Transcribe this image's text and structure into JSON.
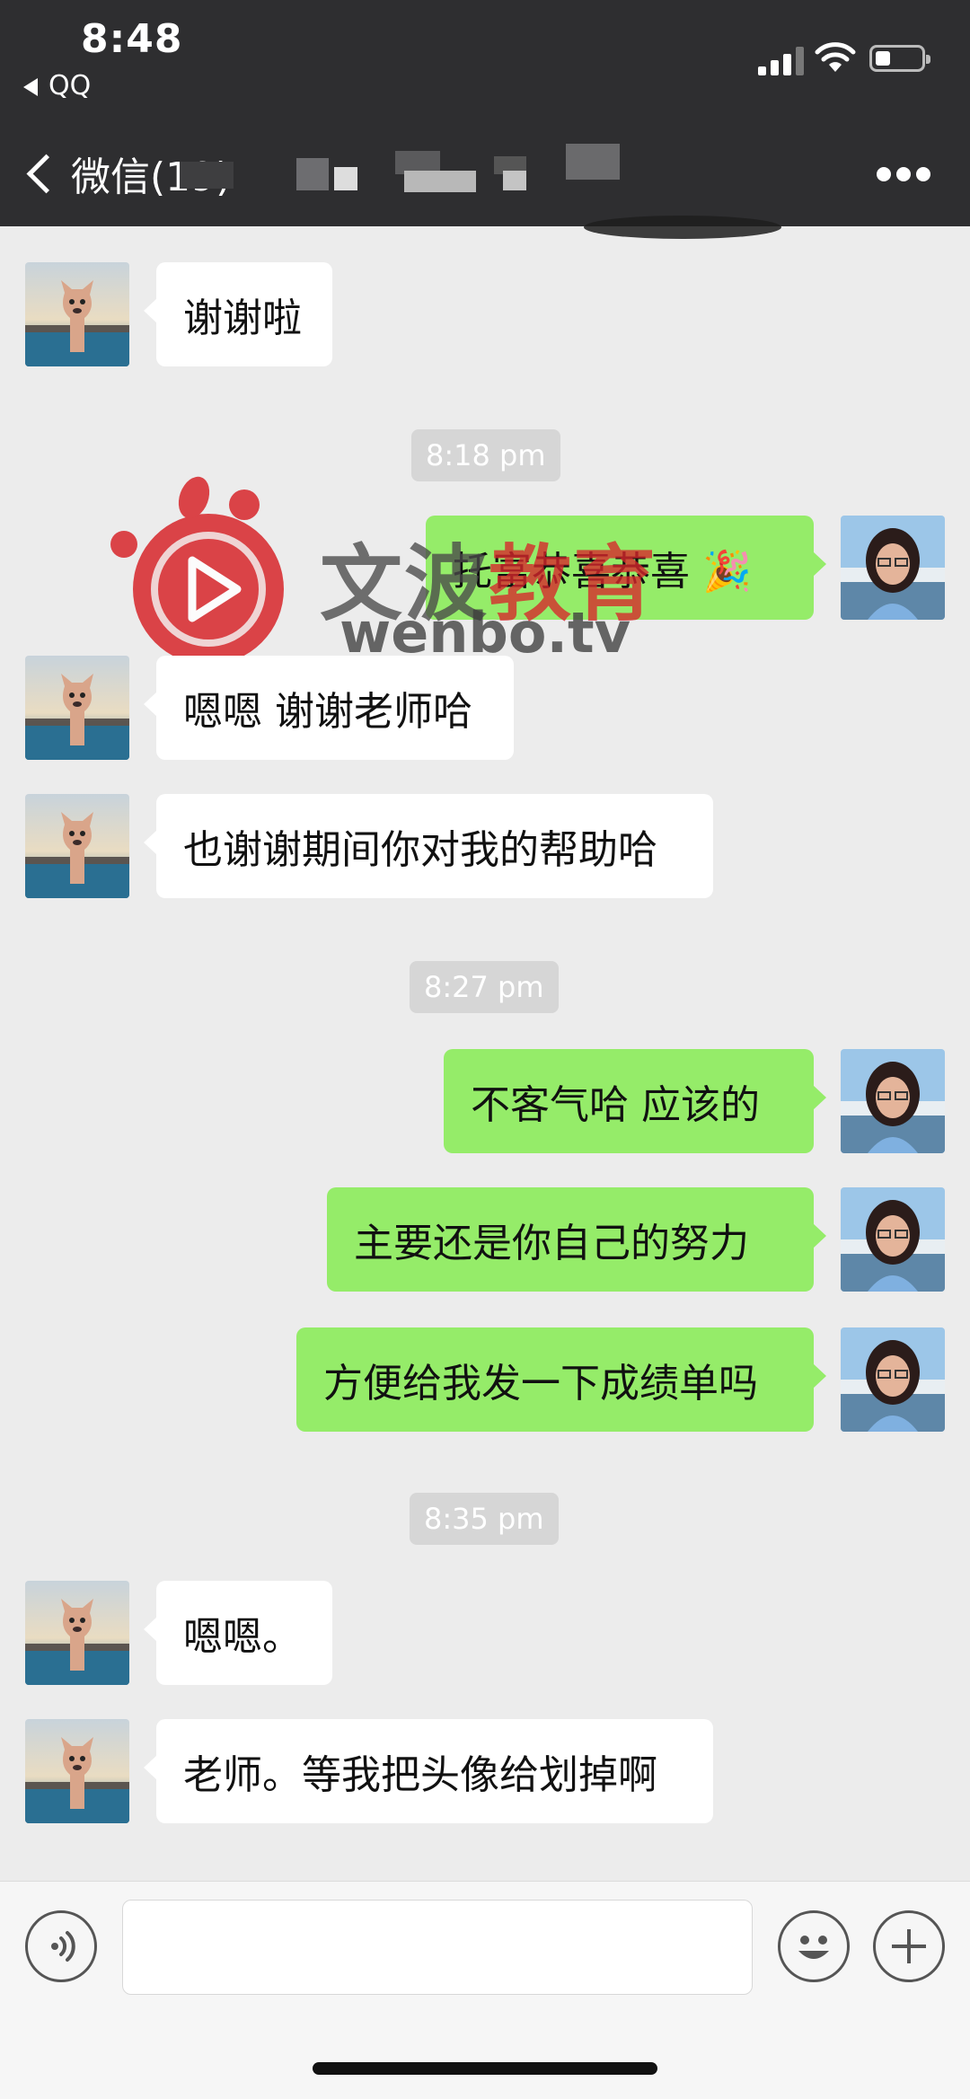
{
  "status_bar": {
    "time": "8:48",
    "back_app": "QQ",
    "signal_icon": "cellular-signal-icon",
    "wifi_icon": "wifi-icon",
    "battery_icon": "battery-icon"
  },
  "nav": {
    "back_label": "微信(19)",
    "back_icon": "chevron-left-icon",
    "title_hidden": true,
    "more_icon": "more-dots-icon"
  },
  "watermark": {
    "brand_gray": "文波",
    "brand_red": "教育",
    "url": "wenbo.tv",
    "accent_color": "#d8262b"
  },
  "messages": [
    {
      "side": "in",
      "text": "谢谢啦"
    },
    {
      "time": "8:18 pm"
    },
    {
      "side": "out",
      "text": "托富恭喜恭喜 🎉"
    },
    {
      "side": "in",
      "text": "嗯嗯 谢谢老师哈"
    },
    {
      "side": "in",
      "text": "也谢谢期间你对我的帮助哈"
    },
    {
      "time": "8:27 pm"
    },
    {
      "side": "out",
      "text": "不客气哈 应该的"
    },
    {
      "side": "out",
      "text": "主要还是你自己的努力"
    },
    {
      "side": "out",
      "text": "方便给我发一下成绩单吗"
    },
    {
      "time": "8:35 pm"
    },
    {
      "side": "in",
      "text": "嗯嗯。"
    },
    {
      "side": "in",
      "text": "老师。等我把头像给划掉啊"
    }
  ],
  "input_bar": {
    "voice_icon": "voice-icon",
    "emoji_icon": "emoji-icon",
    "plus_icon": "plus-icon",
    "input_value": ""
  },
  "colors": {
    "header_bg": "#2e2e30",
    "chat_bg": "#ececec",
    "out_bubble": "#95ec69",
    "in_bubble": "#ffffff"
  }
}
